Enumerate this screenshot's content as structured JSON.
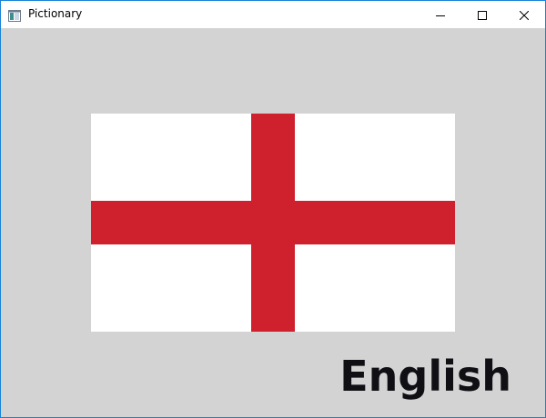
{
  "window": {
    "title": "Pictionary",
    "app_icon": "app-window-icon",
    "controls": {
      "minimize_icon": "minimize-icon",
      "maximize_icon": "maximize-icon",
      "close_icon": "close-icon"
    }
  },
  "content": {
    "flag": {
      "name": "england-flag-image",
      "background_color": "#ffffff",
      "cross_color": "#cf202e"
    },
    "word": "English"
  },
  "colors": {
    "client_background": "#d3d3d3",
    "titlebar_background": "#ffffff",
    "window_border": "#1883d7",
    "word_color": "#0f0f14"
  }
}
